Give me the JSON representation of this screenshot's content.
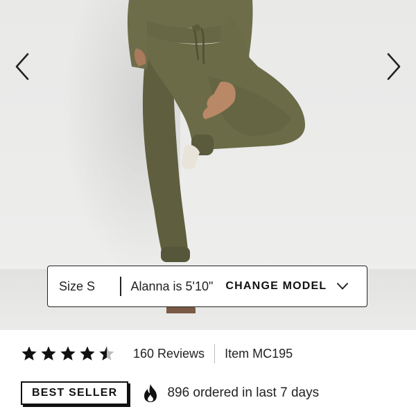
{
  "product": {
    "image_alt": "olive green jogger sweatpants on model",
    "colors": {
      "fabric": "#6b6b47",
      "fabric_shadow": "#555538",
      "skin": "#b98866",
      "background": "#ebebea"
    }
  },
  "carousel": {
    "prev_icon": "chevron-left-icon",
    "next_icon": "chevron-right-icon"
  },
  "model_bar": {
    "size": "Size S",
    "model_info": "Alanna is 5'10\"",
    "change_label": "CHANGE MODEL",
    "chevron_icon": "chevron-down-icon"
  },
  "rating": {
    "stars": 4.5,
    "max": 5,
    "reviews_text": "160 Reviews",
    "item_text": "Item MC195"
  },
  "badge": {
    "label": "BEST SELLER",
    "flame_icon": "flame-icon",
    "ordered_text": "896 ordered in last 7 days"
  }
}
